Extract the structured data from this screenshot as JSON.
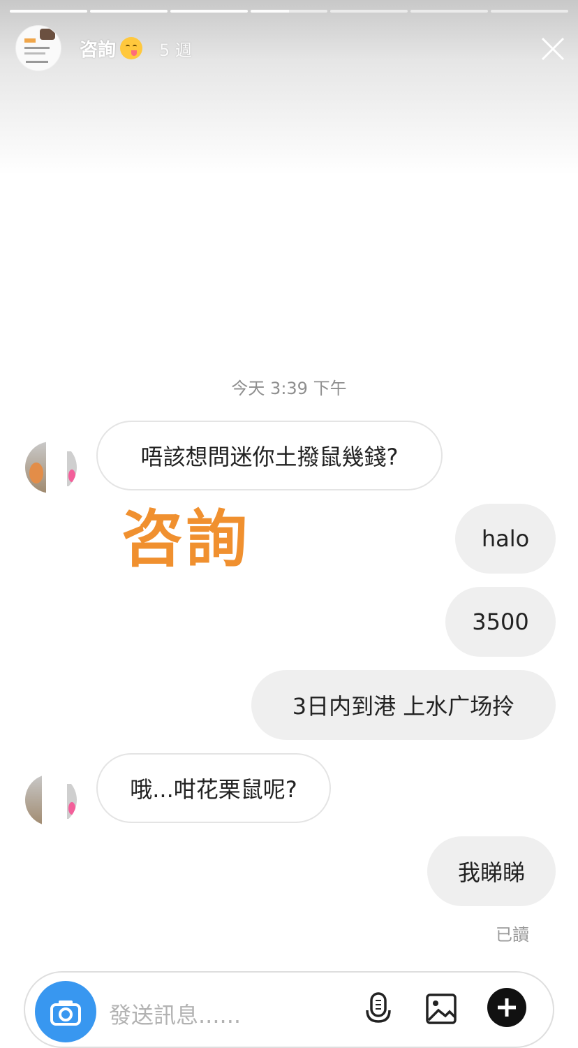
{
  "story": {
    "username": "咨詢",
    "time_ago": "5 週",
    "segments": [
      1,
      1,
      1,
      0.5,
      0,
      0,
      0
    ]
  },
  "chat": {
    "timestamp": "今天 3:39 下午",
    "messages": [
      {
        "side": "in",
        "text": "唔該想問迷你土撥鼠幾錢?"
      },
      {
        "side": "out",
        "text": "halo"
      },
      {
        "side": "out",
        "text": "3500"
      },
      {
        "side": "out",
        "text": "3日内到港 上水广场拎"
      },
      {
        "side": "in",
        "text": "哦...咁花栗鼠呢?"
      },
      {
        "side": "out",
        "text": "我睇睇"
      }
    ],
    "read_status": "已讀"
  },
  "overlay": {
    "text": "咨詢",
    "color": "#f0902f"
  },
  "composer": {
    "placeholder": "發送訊息......",
    "icons": [
      "camera-icon",
      "microphone-icon",
      "gallery-icon",
      "add-icon"
    ],
    "accent": "#3897f0"
  }
}
